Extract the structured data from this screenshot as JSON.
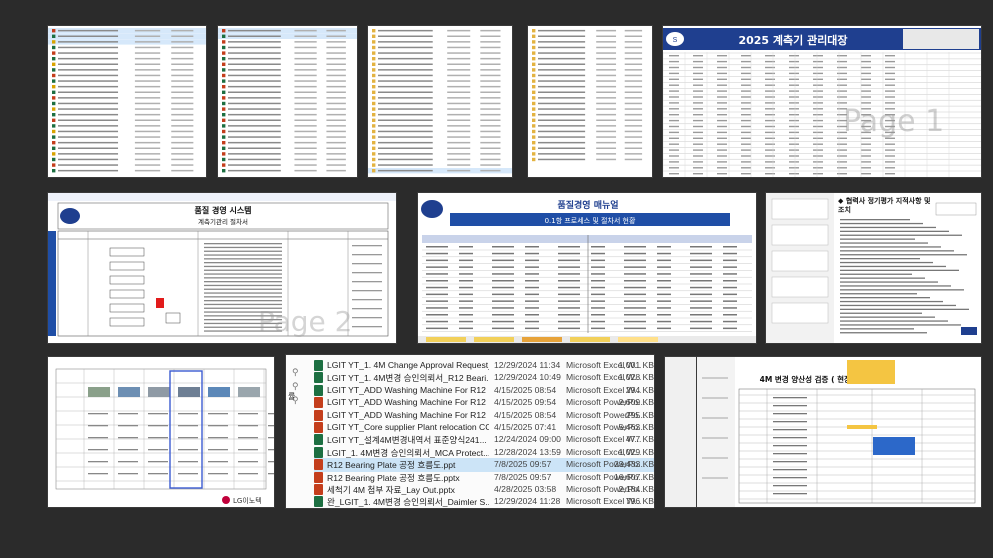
{
  "thumbnails": {
    "t5_title": "2025 계측기 관리대장",
    "t5_watermark": "Page 1",
    "t6_title": "품질 경영 시스템",
    "t6_subtitle": "계측기관리 절차서",
    "t6_watermark": "Page 2",
    "t7_title": "품질경영 매뉴얼",
    "t7_subtitle": "0.1항 프로세스 및 절차서 현황",
    "t8_title": "◆ 협력사 정기평가 지적사항 및",
    "t8_title2": "조치",
    "t11_title": "4M 변경 양산성 검증 ( 현장)",
    "t9_logo": "LG이노텍"
  },
  "file_list": {
    "pinned_label": "률",
    "rows": [
      {
        "name": "LGIT YT_1. 4M Change Approval Request_...",
        "date": "12/29/2024 11:34",
        "type": "Microsoft Excel W...",
        "size": "1,001 KB",
        "icon": "excel"
      },
      {
        "name": "LGIT YT_1. 4M변경 승인의뢰서_R12 Beari...",
        "date": "12/29/2024 10:49",
        "type": "Microsoft Excel W...",
        "size": "1,028 KB",
        "icon": "excel"
      },
      {
        "name": "LGIT YT_ADD Washing Machine For R12 ...",
        "date": "4/15/2025 08:54",
        "type": "Microsoft Excel W...",
        "size": "294 KB",
        "icon": "excel"
      },
      {
        "name": "LGIT YT_ADD Washing Machine For R12 ...",
        "date": "4/15/2025 09:54",
        "type": "Microsoft PowerPo...",
        "size": "2,609 KB",
        "icon": "ppt"
      },
      {
        "name": "LGIT YT_ADD Washing Machine For R12 ...",
        "date": "4/15/2025 08:54",
        "type": "Microsoft PowerPo...",
        "size": "295 KB",
        "icon": "ppt"
      },
      {
        "name": "LGIT YT_Core supplier Plant relocation CC...",
        "date": "4/15/2025 07:41",
        "type": "Microsoft PowerPo...",
        "size": "5,463 KB",
        "icon": "ppt"
      },
      {
        "name": "LGIT YT_설계4M변경내역서 표준양식241...",
        "date": "12/24/2024 09:00",
        "type": "Microsoft Excel W...",
        "size": "477 KB",
        "icon": "excel"
      },
      {
        "name": "LGIT_1. 4M변경 승인의뢰서_MCA Protect...",
        "date": "12/28/2024 13:59",
        "type": "Microsoft Excel W...",
        "size": "1,029 KB",
        "icon": "excel"
      },
      {
        "name": "R12 Bearing Plate 공정 흐름도.ppt",
        "date": "7/8/2025 09:57",
        "type": "Microsoft PowerPo...",
        "size": "23,433 KB",
        "icon": "ppt",
        "selected": true
      },
      {
        "name": "R12 Bearing Plate 공정 흐름도.pptx",
        "date": "7/8/2025 09:57",
        "type": "Microsoft PowerPo...",
        "size": "16,607 KB",
        "icon": "ppt"
      },
      {
        "name": "세척기 4M 첨부 자료_Lay Out.pptx",
        "date": "4/28/2025 03:58",
        "type": "Microsoft PowerPo...",
        "size": "2,184 KB",
        "icon": "ppt"
      },
      {
        "name": "완_LGIT_1. 4M변경 승인의뢰서_Daimler S...",
        "date": "12/29/2024 11:28",
        "type": "Microsoft Excel W...",
        "size": "796 KB",
        "icon": "excel"
      }
    ]
  },
  "colors": {
    "background": "#2b2b2b",
    "excel_icon": "#1d6f42",
    "ppt_icon": "#c43e1c",
    "selection": "#cce4f7",
    "header_blue": "#1f3f8f"
  }
}
